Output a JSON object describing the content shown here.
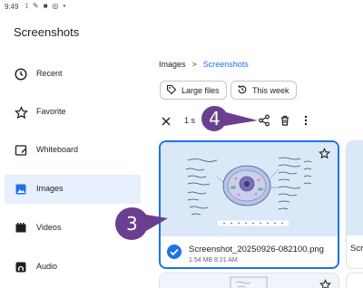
{
  "status_bar": {
    "time": "9:49"
  },
  "app": {
    "title": "Screenshots"
  },
  "sidebar": {
    "items": [
      {
        "label": "Recent",
        "icon": "clock-icon",
        "active": false
      },
      {
        "label": "Favorite",
        "icon": "star-icon",
        "active": false
      },
      {
        "label": "Whiteboard",
        "icon": "whiteboard-icon",
        "active": false
      },
      {
        "label": "Images",
        "icon": "image-icon",
        "active": true
      },
      {
        "label": "Videos",
        "icon": "video-icon",
        "active": false
      },
      {
        "label": "Audio",
        "icon": "audio-icon",
        "active": false
      }
    ]
  },
  "breadcrumb": {
    "root": "Images",
    "separator": ">",
    "current": "Screenshots"
  },
  "filters": {
    "large_files": "Large files",
    "this_week": "This week"
  },
  "selection_bar": {
    "count_text": "1 s"
  },
  "files": [
    {
      "name": "Screenshot_20250926-082100.png",
      "meta": "1.54 MB 8:21 AM",
      "selected": true
    },
    {
      "name": "Scr"
    }
  ],
  "annotations": [
    {
      "number": "4",
      "points_to": "share-button"
    },
    {
      "number": "3",
      "points_to": "selected-file-card"
    }
  ],
  "colors": {
    "accent": "#1a73e8",
    "active_bg": "#e8f0fe",
    "callout": "#6b3f8f",
    "thumbnail_bg": "#dbe8f8"
  }
}
